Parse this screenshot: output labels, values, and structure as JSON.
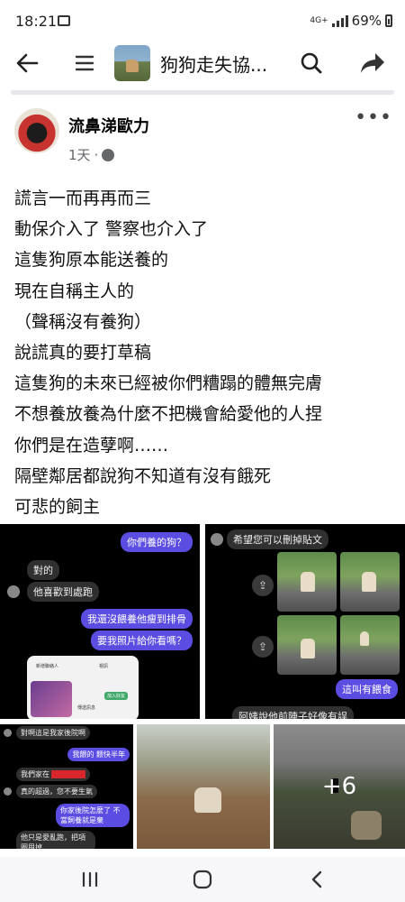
{
  "status": {
    "time": "18:21",
    "network": "4G+",
    "battery": "69%"
  },
  "toolbar": {
    "group_title": "狗狗走失協..."
  },
  "post": {
    "author": "流鼻涕歐力",
    "time": "1天",
    "text_lines": [
      "謊言一而再再而三",
      "動保介入了 警察也介入了",
      "這隻狗原本能送養的",
      "現在自稱主人的",
      "（聲稱沒有養狗）",
      "說謊真的要打草稿",
      "這隻狗的未來已經被你們糟蹋的體無完膚",
      "不想養放養為什麼不把機會給愛他的人捏",
      "你們是在造孽啊……",
      "隔壁鄰居都說狗不知道有沒有餓死",
      "可悲的飼主"
    ]
  },
  "media": {
    "chat1": {
      "q": "你們養的狗？",
      "a1": "對的",
      "a2": "他喜歡到處跑",
      "b1": "我還沒餵養他瘦到排骨",
      "b2": "要我照片給你看嗎？",
      "phone_labels": [
        "新增聯絡人",
        "視訊",
        "加入好友",
        "傳送訊息"
      ]
    },
    "chat2": {
      "top": "希望您可以刪掉貼文",
      "r1": "這叫有餵食",
      "bottom": "阿姨說他前陣子好像有誤"
    },
    "chat3": {
      "l1": "對啊這是我家後院啊",
      "r1": "我餵的 餵快半年",
      "l2": "我們家在",
      "l3": "真的超過，您不要生氣",
      "r2": "你家後院怎麼了 不當飼養就是棄",
      "l4": "他只是愛亂跑，把項圈甩掉"
    },
    "more_count": "+6"
  },
  "colors": {
    "accent_purple": "#5b4de1",
    "divider": "#e4e6eb",
    "meta_gray": "#65676b"
  }
}
